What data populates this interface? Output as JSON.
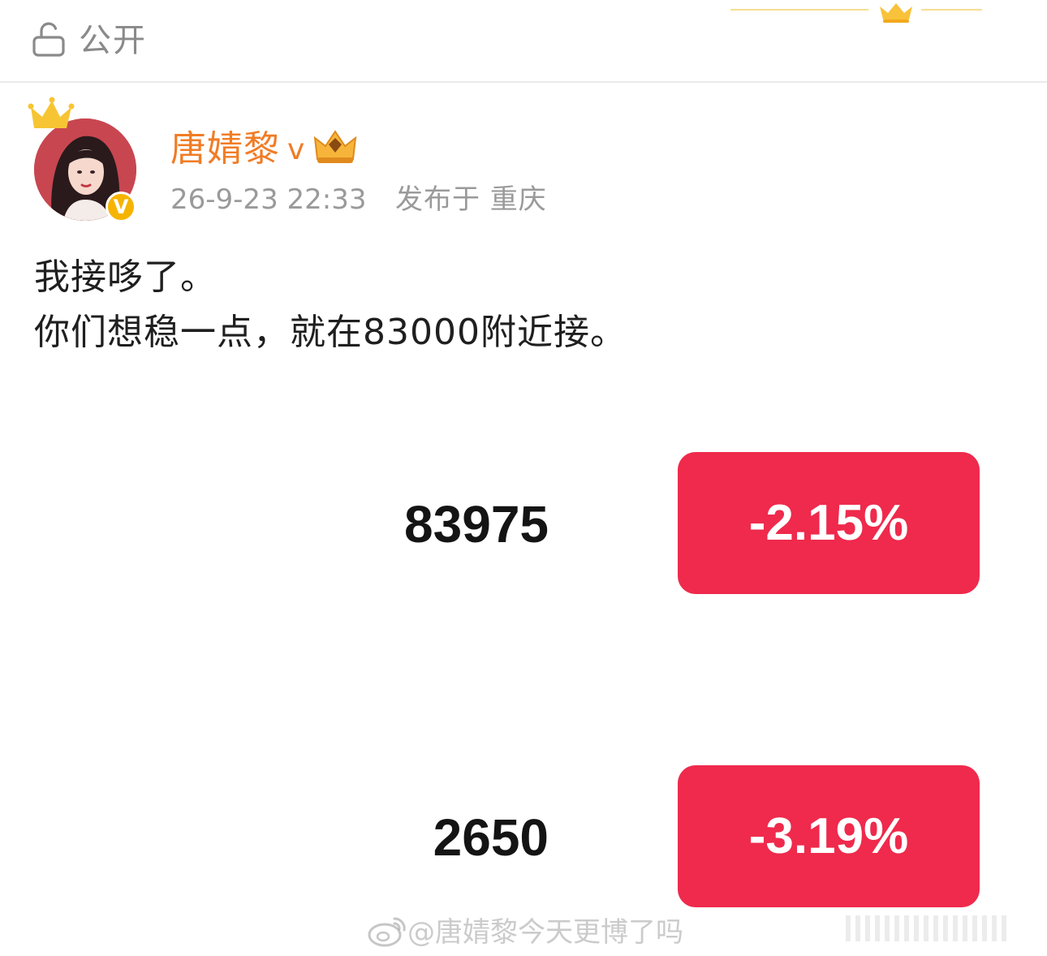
{
  "header": {
    "privacy_label": "公开"
  },
  "post": {
    "author": {
      "name": "唐婧黎",
      "vip_mark": "v",
      "verified_badge": "V"
    },
    "time": "26-9-23 22:33",
    "location": "发布于 重庆",
    "lines": [
      "我接哆了。",
      "你们想稳一点，就在83000附近接。"
    ]
  },
  "quotes": [
    {
      "value": "83975",
      "change": "-2.15%"
    },
    {
      "value": "2650",
      "change": "-3.19%"
    }
  ],
  "watermark": {
    "text": "@唐婧黎今天更博了吗"
  },
  "colors": {
    "username": "#f07c25",
    "meta": "#9a9a9a",
    "change_badge": "#ef2a4c",
    "verified_badge": "#f6b400"
  }
}
